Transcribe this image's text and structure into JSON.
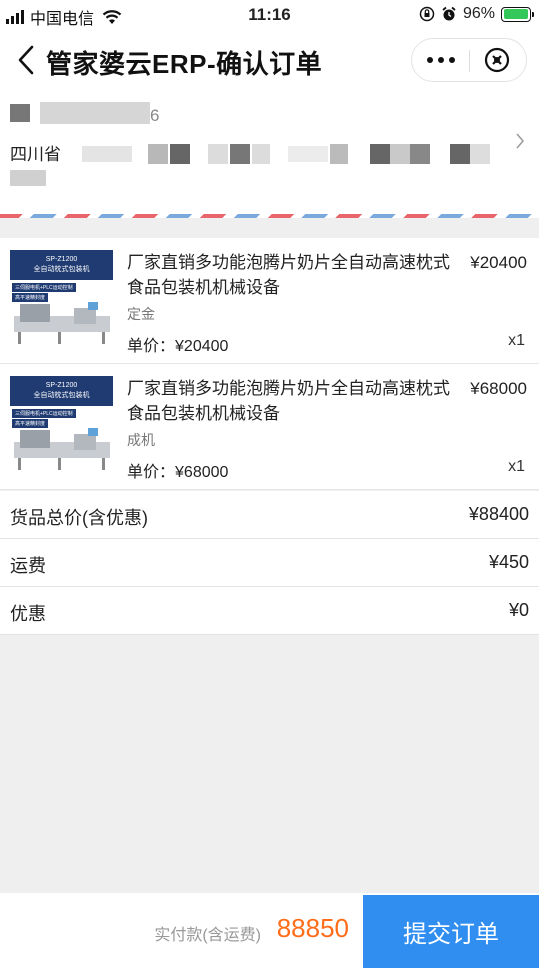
{
  "status_bar": {
    "carrier": "中国电信",
    "time": "11:16",
    "battery_percent": "96%",
    "battery_level": 0.96
  },
  "nav": {
    "title": "管家婆云ERP-确认订单",
    "back_icon": "chevron-left-icon",
    "more_icon": "more-dots-icon",
    "close_icon": "close-circle-icon"
  },
  "address": {
    "name_visible_fragment": "6",
    "province_visible_fragment": "四川省"
  },
  "products": [
    {
      "title": "厂家直销多功能泡腾片奶片全自动高速枕式食品包装机机械设备",
      "price": "¥20400",
      "spec": "定金",
      "unit_price_label": "单价：",
      "unit_price": "¥20400",
      "quantity": "x1",
      "thumb": {
        "model": "SP-Z1200",
        "caption": "全自动枕式包装机",
        "tag1": "三伺服电机+PLC运动控制",
        "tag2": "高平速精封度"
      }
    },
    {
      "title": "厂家直销多功能泡腾片奶片全自动高速枕式食品包装机机械设备",
      "price": "¥68000",
      "spec": "成机",
      "unit_price_label": "单价：",
      "unit_price": "¥68000",
      "quantity": "x1",
      "thumb": {
        "model": "SP-Z1200",
        "caption": "全自动枕式包装机",
        "tag1": "三伺服电机+PLC运动控制",
        "tag2": "高平速精封度"
      }
    }
  ],
  "summary": {
    "goods_total_label": "货品总价(含优惠)",
    "goods_total": "¥88400",
    "shipping_label": "运费",
    "shipping": "¥450",
    "discount_label": "优惠",
    "discount": "¥0"
  },
  "footer": {
    "pay_label": "实付款(含运费)",
    "pay_amount": "88850",
    "submit_label": "提交订单"
  },
  "colors": {
    "accent": "#2f8ef0",
    "amount": "#ff6d1b",
    "page_bg": "#efefef"
  }
}
